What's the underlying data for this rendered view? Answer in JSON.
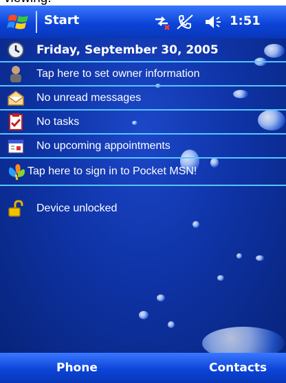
{
  "caption": {
    "text": "viewing."
  },
  "title_bar": {
    "title": "Start",
    "clock": "1:51"
  },
  "today": {
    "items": [
      {
        "icon": "clock-icon",
        "label": "Friday, September 30, 2005"
      },
      {
        "icon": "owner-icon",
        "label": "Tap here to set owner information"
      },
      {
        "icon": "envelope-icon",
        "label": "No unread messages"
      },
      {
        "icon": "tasks-icon",
        "label": "No tasks"
      },
      {
        "icon": "calendar-icon",
        "label": "No upcoming appointments"
      },
      {
        "icon": "msn-butterfly-icon",
        "label": "Tap here to sign in to Pocket MSN!"
      },
      {
        "icon": "padlock-icon",
        "label": "Device unlocked"
      }
    ]
  },
  "menu_bar": {
    "left": "Phone",
    "right": "Contacts"
  },
  "colors": {
    "titlebar": "#0c44d8",
    "background": "#0f34a8",
    "row_separator": "#58c7ff"
  }
}
